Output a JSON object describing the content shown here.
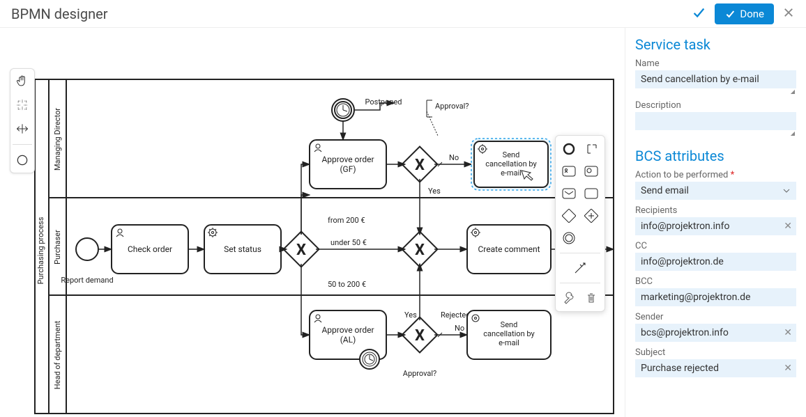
{
  "header": {
    "title": "BPMN designer",
    "done_label": "Done"
  },
  "tool_palette": {
    "hand": "hand-tool",
    "lasso": "lasso-tool",
    "space": "space-tool",
    "global_connect": "global-connect-tool",
    "start_event": "start-event-tool"
  },
  "pool": {
    "name": "Purchasing process"
  },
  "lanes": [
    {
      "name": "Managing Director"
    },
    {
      "name": "Purchaser"
    },
    {
      "name": "Head of department"
    }
  ],
  "tasks": {
    "check_order": "Check order",
    "set_status": "Set status",
    "approve_gf": "Approve order (GF)",
    "send_cancel_gf": "Send cancellation by e-mail",
    "create_comment": "Create comment",
    "approve_al": "Approve order (AL)",
    "send_cancel_al": "Send cancellation by e-mail"
  },
  "labels": {
    "report_demand": "Report demand",
    "postponed": "Postponed",
    "approval_gf": "Approval?",
    "approval_al": "Approval?",
    "no_gf": "No",
    "yes_gf": "Yes",
    "yes_al": "Yes",
    "no_al": "No",
    "rejected": "Rejected",
    "from_200": "from 200 €",
    "under_50": "under 50 €",
    "between_50_200": "50 to 200 €"
  },
  "context_pad": {
    "start_event": "append-start-event",
    "end_event": "append-end-event",
    "user_task": "append-user-task",
    "service_task": "append-service-task",
    "send_task": "append-send-task",
    "receive_task": "append-receive-task",
    "gateway_xor": "append-xor-gateway",
    "gateway_parallel": "append-parallel-gateway",
    "intermediate": "append-intermediate-event",
    "connect": "connect",
    "wrench": "change-type",
    "trash": "delete"
  },
  "side_panel": {
    "title": "Service task",
    "name_label": "Name",
    "name_value": "Send cancellation by e-mail",
    "description_label": "Description",
    "description_value": "",
    "attrs_title": "BCS attributes",
    "action_label": "Action to be performed",
    "action_value": "Send email",
    "recipients_label": "Recipients",
    "recipients_value": "info@projektron.info",
    "cc_label": "CC",
    "cc_value": "info@projektron.de",
    "bcc_label": "BCC",
    "bcc_value": "marketing@projektron.de",
    "sender_label": "Sender",
    "sender_value": "bcs@projektron.info",
    "subject_label": "Subject",
    "subject_value": "Purchase rejected"
  }
}
